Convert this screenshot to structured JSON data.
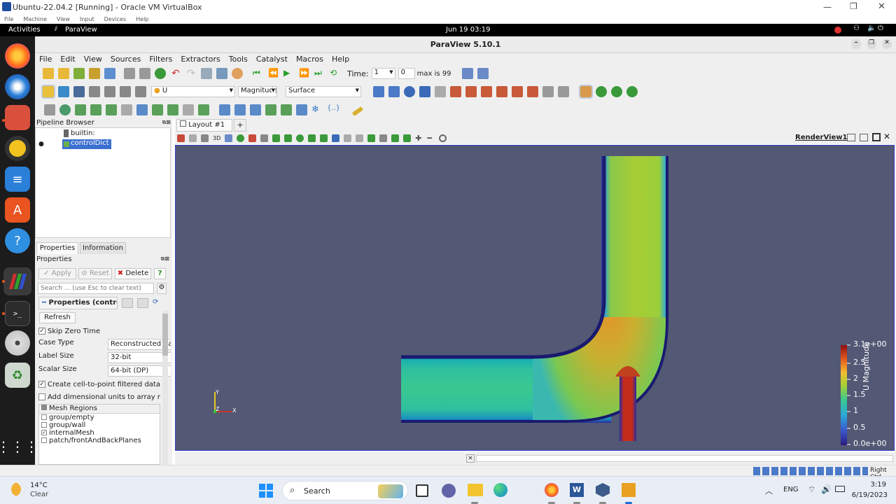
{
  "vbox": {
    "title": "Ubuntu-22.04.2 [Running] - Oracle VM VirtualBox",
    "menu": [
      "File",
      "Machine",
      "View",
      "Input",
      "Devices",
      "Help"
    ]
  },
  "gnome": {
    "activities": "Activities",
    "app": "ParaView",
    "clock": "Jun 19  03:19"
  },
  "paraview": {
    "title": "ParaView 5.10.1",
    "menu": [
      "File",
      "Edit",
      "View",
      "Sources",
      "Filters",
      "Extractors",
      "Tools",
      "Catalyst",
      "Macros",
      "Help"
    ],
    "time_label": "Time:",
    "time_value": "1",
    "step_value": "0",
    "max_text": "max is 99",
    "variable": "U",
    "component": "Magnitude",
    "representation": "Surface"
  },
  "pipeline": {
    "title": "Pipeline Browser",
    "items": [
      "builtin:",
      "controlDict"
    ]
  },
  "properties": {
    "tabs": [
      "Properties",
      "Information"
    ],
    "title": "Properties",
    "apply": "Apply",
    "reset": "Reset",
    "delete": "Delete",
    "help": "?",
    "search_placeholder": "Search ... (use Esc to clear text)",
    "section": "Properties (controlDict)",
    "refresh": "Refresh",
    "skip_zero": "Skip Zero Time",
    "case_type_label": "Case Type",
    "case_type": "Reconstructed Case",
    "label_size_label": "Label Size",
    "label_size": "32-bit",
    "scalar_size_label": "Scalar Size",
    "scalar_size": "64-bit (DP)",
    "create_c2p": "Create cell-to-point filtered data",
    "add_units": "Add dimensional units to array names",
    "mesh_regions": "Mesh Regions",
    "regions": [
      {
        "name": "group/empty",
        "checked": false
      },
      {
        "name": "group/wall",
        "checked": false
      },
      {
        "name": "internalMesh",
        "checked": true
      },
      {
        "name": "patch/frontAndBackPlanes",
        "checked": false
      }
    ]
  },
  "layout": {
    "tab": "Layout #1",
    "add": "+",
    "view_name": "RenderView1",
    "btn_3d": "3D"
  },
  "colorbar": {
    "title": "U Magnitude",
    "ticks": [
      "3.1e+00",
      "2.5",
      "2",
      "1.5",
      "1",
      "0.5",
      "0.0e+00"
    ]
  },
  "axes": {
    "y": "Y",
    "z": "Z",
    "x": "X"
  },
  "statusbar": {
    "host": "Right Ctrl"
  },
  "taskbar": {
    "weather_temp": "14°C",
    "weather_desc": "Clear",
    "search": "Search",
    "lang": "ENG",
    "time": "3:19",
    "date": "6/19/2023"
  },
  "colors": {
    "accent": "#3340c0",
    "render_bg": "#535875",
    "flow_green": "#9ccf3a",
    "flow_red": "#c42c1a"
  }
}
